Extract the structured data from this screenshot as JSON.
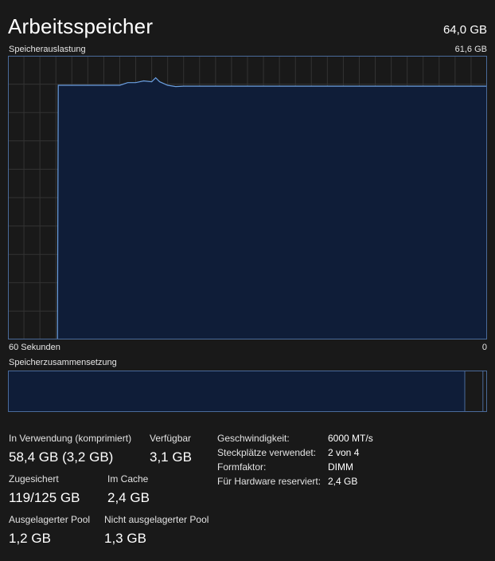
{
  "header": {
    "title": "Arbeitsspeicher",
    "total": "64,0 GB"
  },
  "graph": {
    "label": "Speicherauslastung",
    "max_label": "61,6 GB",
    "x_left_label": "60 Sekunden",
    "x_right_label": "0",
    "line_color": "#6b9fe0",
    "fill_color": "#0f1d38",
    "grid_color": "#333333"
  },
  "composition": {
    "label": "Speicherzusammensetzung",
    "in_use_fraction": 0.955,
    "modified_fraction": 0.0,
    "standby_fraction": 0.038,
    "free_fraction": 0.007
  },
  "stats": {
    "in_use_label": "In Verwendung (komprimiert)",
    "in_use_value": "58,4 GB (3,2 GB)",
    "available_label": "Verfügbar",
    "available_value": "3,1 GB",
    "committed_label": "Zugesichert",
    "committed_value": "119/125 GB",
    "cached_label": "Im Cache",
    "cached_value": "2,4 GB",
    "paged_pool_label": "Ausgelagerter Pool",
    "paged_pool_value": "1,2 GB",
    "nonpaged_pool_label": "Nicht ausgelagerter Pool",
    "nonpaged_pool_value": "1,3 GB"
  },
  "details": {
    "speed_label": "Geschwindigkeit:",
    "speed_value": "6000 MT/s",
    "slots_label": "Steckplätze verwendet:",
    "slots_value": "2 von 4",
    "form_factor_label": "Formfaktor:",
    "form_factor_value": "DIMM",
    "reserved_label": "Für Hardware reserviert:",
    "reserved_value": "2,4 GB"
  },
  "chart_data": {
    "type": "area",
    "ylim": [
      0,
      61.6
    ],
    "xlim": [
      60,
      0
    ],
    "x": [
      60,
      53.8,
      53.7,
      46,
      45,
      44,
      43,
      42,
      41.5,
      41,
      40,
      39,
      38,
      35,
      30,
      0
    ],
    "values": [
      0,
      0,
      57.8,
      57.8,
      58.4,
      58.4,
      58.8,
      58.6,
      59.5,
      58.6,
      57.8,
      57.5,
      57.6,
      57.6,
      57.6,
      57.6
    ]
  }
}
